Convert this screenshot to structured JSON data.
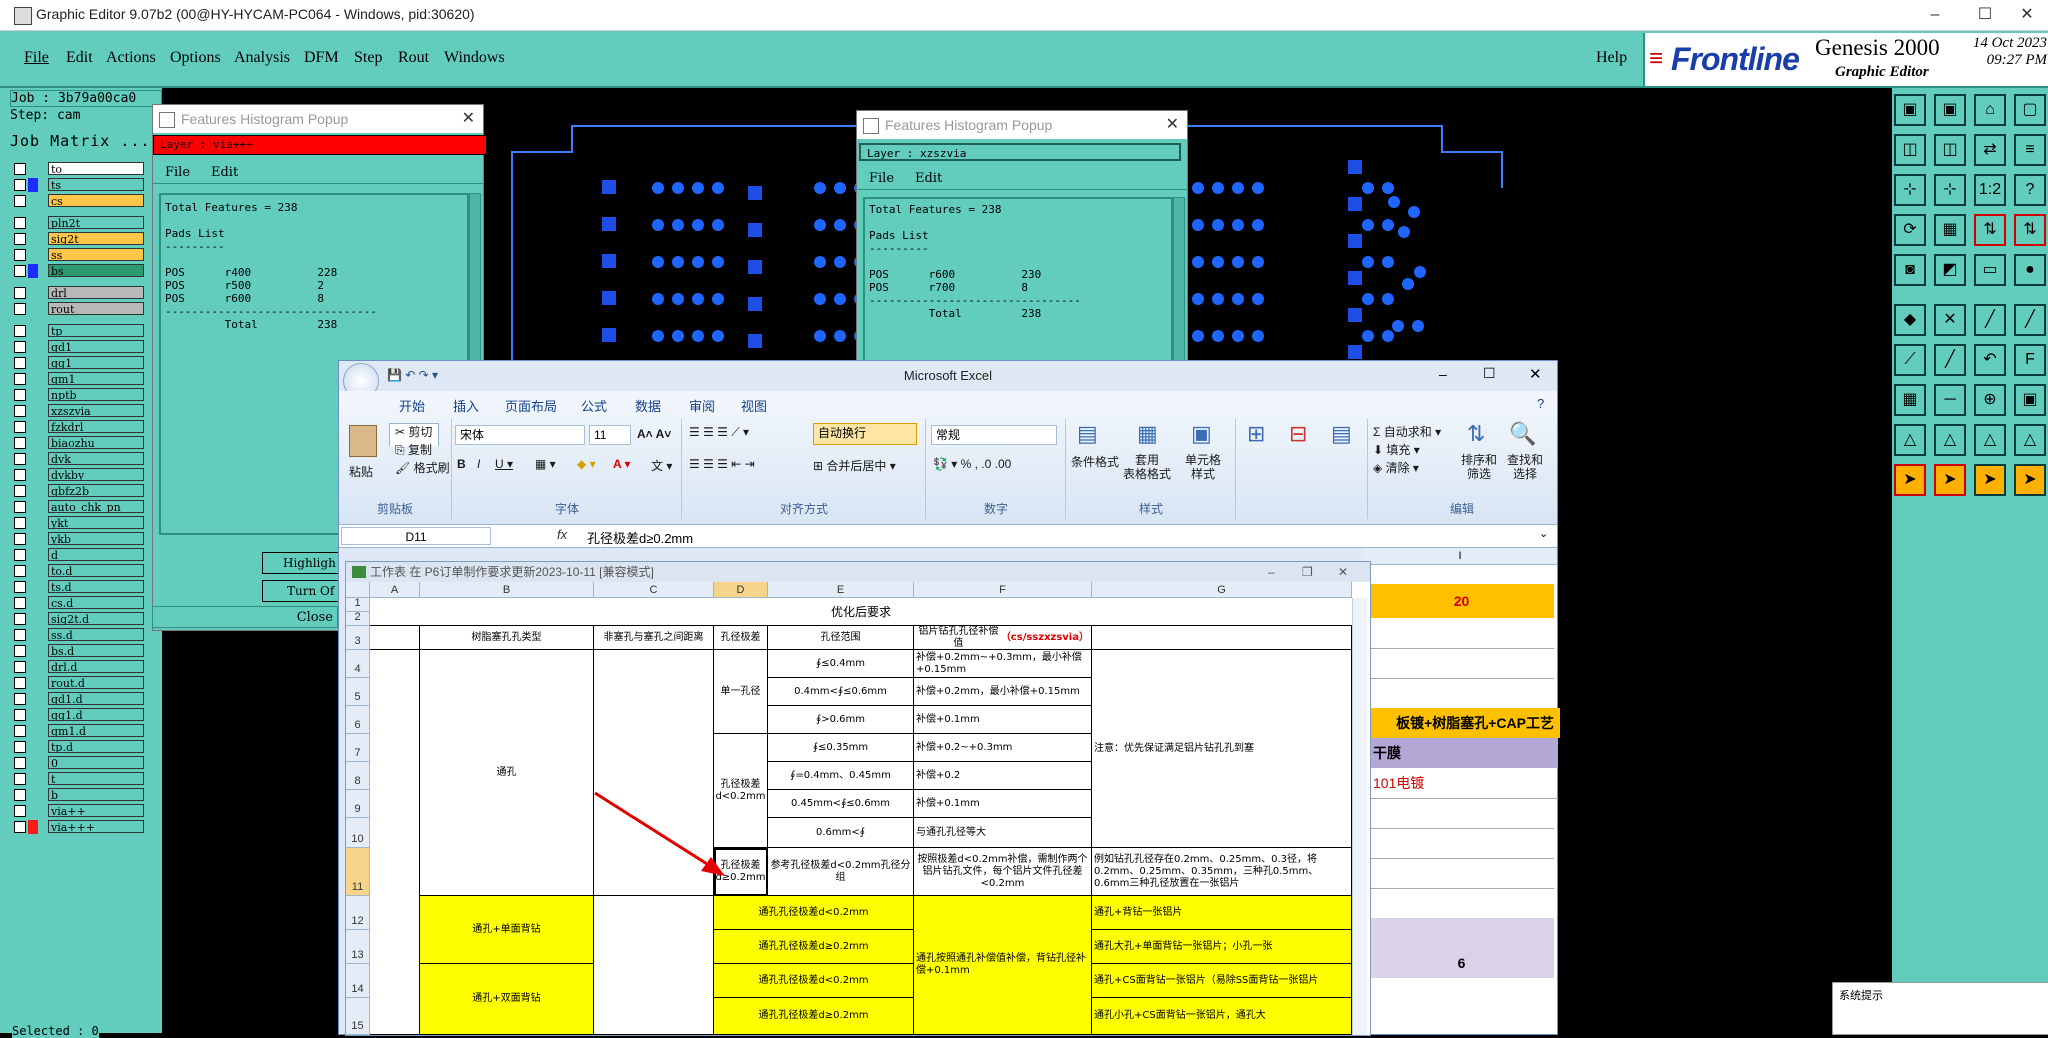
{
  "genesis": {
    "title": "Graphic Editor 9.07b2 (00@HY-HYCAM-PC064 - Windows, pid:30620)",
    "menu": [
      "File",
      "Edit",
      "Actions",
      "Options",
      "Analysis",
      "DFM",
      "Step",
      "Rout",
      "Windows"
    ],
    "help": "Help",
    "brand": "Frontline",
    "product": "Genesis 2000",
    "subtitle": "Graphic Editor",
    "date": "14 Oct 2023",
    "time": "09:27 PM",
    "job_line": "Job : 3b79a00ca0",
    "step_line": "Step: cam",
    "job_matrix": "Job Matrix ...",
    "selected": "Selected : 0"
  },
  "layers": [
    {
      "name": "to",
      "color": "#ffffff",
      "sw": "#62cdbd"
    },
    {
      "name": "ts",
      "color": "#62cdbd",
      "sw": "#1e2cff"
    },
    {
      "name": "cs",
      "color": "#ffc64a",
      "sw": "#62cdbd"
    },
    {
      "name": "pln2t",
      "color": "#62cdbd",
      "sw": "#62cdbd"
    },
    {
      "name": "sig2t",
      "color": "#ffc64a",
      "sw": "#62cdbd"
    },
    {
      "name": "ss",
      "color": "#ffc64a",
      "sw": "#62cdbd"
    },
    {
      "name": "bs",
      "color": "#2d9a70",
      "sw": "#1e2cff"
    },
    {
      "name": "drl",
      "color": "#b8b8b8",
      "sw": "#62cdbd"
    },
    {
      "name": "rout",
      "color": "#b8b8b8",
      "sw": "#62cdbd"
    },
    {
      "name": "tp",
      "color": "#62cdbd",
      "sw": "#62cdbd"
    },
    {
      "name": "gd1",
      "color": "#62cdbd",
      "sw": "#62cdbd"
    },
    {
      "name": "gg1",
      "color": "#62cdbd",
      "sw": "#62cdbd"
    },
    {
      "name": "gm1",
      "color": "#62cdbd",
      "sw": "#62cdbd"
    },
    {
      "name": "nptb",
      "color": "#62cdbd",
      "sw": "#62cdbd"
    },
    {
      "name": "xzszvia",
      "color": "#62cdbd",
      "sw": "#62cdbd"
    },
    {
      "name": "fzkdrl",
      "color": "#62cdbd",
      "sw": "#62cdbd"
    },
    {
      "name": "biaozhu",
      "color": "#62cdbd",
      "sw": "#62cdbd"
    },
    {
      "name": "dvk",
      "color": "#62cdbd",
      "sw": "#62cdbd"
    },
    {
      "name": "dvkby",
      "color": "#62cdbd",
      "sw": "#62cdbd"
    },
    {
      "name": "gbfz2b",
      "color": "#62cdbd",
      "sw": "#62cdbd"
    },
    {
      "name": "auto_chk_pn",
      "color": "#62cdbd",
      "sw": "#62cdbd"
    },
    {
      "name": "ykt",
      "color": "#62cdbd",
      "sw": "#62cdbd"
    },
    {
      "name": "ykb",
      "color": "#62cdbd",
      "sw": "#62cdbd"
    },
    {
      "name": "d",
      "color": "#62cdbd",
      "sw": "#62cdbd"
    },
    {
      "name": "to.d",
      "color": "#62cdbd",
      "sw": "#62cdbd"
    },
    {
      "name": "ts.d",
      "color": "#62cdbd",
      "sw": "#62cdbd"
    },
    {
      "name": "cs.d",
      "color": "#62cdbd",
      "sw": "#62cdbd"
    },
    {
      "name": "sig2t.d",
      "color": "#62cdbd",
      "sw": "#62cdbd"
    },
    {
      "name": "ss.d",
      "color": "#62cdbd",
      "sw": "#62cdbd"
    },
    {
      "name": "bs.d",
      "color": "#62cdbd",
      "sw": "#62cdbd"
    },
    {
      "name": "drl.d",
      "color": "#62cdbd",
      "sw": "#62cdbd"
    },
    {
      "name": "rout.d",
      "color": "#62cdbd",
      "sw": "#62cdbd"
    },
    {
      "name": "gd1.d",
      "color": "#62cdbd",
      "sw": "#62cdbd"
    },
    {
      "name": "gg1.d",
      "color": "#62cdbd",
      "sw": "#62cdbd"
    },
    {
      "name": "gm1.d",
      "color": "#62cdbd",
      "sw": "#62cdbd"
    },
    {
      "name": "tp.d",
      "color": "#62cdbd",
      "sw": "#62cdbd"
    },
    {
      "name": "0",
      "color": "#62cdbd",
      "sw": "#62cdbd"
    },
    {
      "name": "t",
      "color": "#62cdbd",
      "sw": "#62cdbd"
    },
    {
      "name": "b",
      "color": "#62cdbd",
      "sw": "#62cdbd"
    },
    {
      "name": "via++",
      "color": "#62cdbd",
      "sw": "#62cdbd"
    },
    {
      "name": "via+++",
      "color": "#62cdbd",
      "sw": "#ff1a1a"
    }
  ],
  "popup1": {
    "title": "Features Histogram Popup",
    "layer": "Layer :  via+++",
    "menu_file": "File",
    "menu_edit": "Edit",
    "body": "Total Features = 238\n\nPads List\n---------\n\nPOS      r400          228\nPOS      r500          2\nPOS      r600          8\n--------------------------------\n         Total         238",
    "highlight": "Highligh",
    "turn_off": "Turn Of",
    "close": "Close"
  },
  "popup2": {
    "title": "Features Histogram Popup",
    "layer": "Layer :  xzszvia",
    "menu_file": "File",
    "menu_edit": "Edit",
    "body": "Total Features = 238\n\nPads List\n---------\n\nPOS      r600          230\nPOS      r700          8\n--------------------------------\n         Total         238"
  },
  "excel": {
    "title": "Microsoft Excel",
    "tabs": [
      "开始",
      "插入",
      "页面布局",
      "公式",
      "数据",
      "审阅",
      "视图"
    ],
    "clipboard": {
      "paste": "粘贴",
      "cut": "剪切",
      "copy": "复制",
      "format_painter": "格式刷",
      "label": "剪贴板"
    },
    "font": {
      "name": "宋体",
      "size": "11",
      "label": "字体"
    },
    "align": {
      "wrap": "自动换行",
      "merge": "合并后居中",
      "label": "对齐方式"
    },
    "number": {
      "format": "常规",
      "label": "数字"
    },
    "styles": {
      "cond": "条件格式",
      "table": "套用\n表格格式",
      "cell": "单元格\n样式",
      "label": "样式"
    },
    "cells": {
      "header_opt": "优化后要求",
      "h_b": "树脂塞孔孔类型",
      "h_c": "非塞孔与塞孔之间距离",
      "h_d": "孔径极差",
      "h_e": "孔径范围",
      "h_f": "铝片钻孔孔径补偿值",
      "h_f_red": "（cs/sszxzsvia）",
      "b_through": "通孔",
      "d_single": "单一孔径",
      "d_lt": "孔径极差d<0.2mm",
      "d_ge": "孔径极差d≥0.2mm",
      "e4": "∮≤0.4mm",
      "e5": "0.4mm<∮≤0.6mm",
      "e6": "∮>0.6mm",
      "e7": "∮≤0.35mm",
      "e8": "∮=0.4mm、0.45mm",
      "e9": "0.45mm<∮≤0.6mm",
      "e10": "0.6mm<∮",
      "e11": "参考孔径极差d<0.2mm孔径分组",
      "f4": "补偿+0.2mm~+0.3mm，最小补偿+0.15mm",
      "f5": "补偿+0.2mm，最小补偿+0.15mm",
      "f6": "补偿+0.1mm",
      "f7": "补偿+0.2~+0.3mm",
      "f8": "补偿+0.2",
      "f9": "补偿+0.1mm",
      "f10": "与通孔孔径等大",
      "f11": "按照极差d<0.2mm补偿，需制作两个铝片钻孔文件，每个铝片文件孔径差<0.2mm",
      "g_note": "注意：优先保证满足铝片钻孔孔到塞",
      "g11": "例如钻孔孔径存在0.2mm、0.25mm、0.3径，将0.2mm、0.25mm、0.35mm，三种孔0.5mm、0.6mm三种孔径放置在一张铝片",
      "b12": "通孔+单面背钻",
      "b14": "通孔+双面背钻",
      "d12": "通孔孔径极差d<0.2mm",
      "d13": "通孔孔径极差d≥0.2mm",
      "d14": "通孔孔径极差d<0.2mm",
      "d15": "通孔孔径极差d≥0.2mm",
      "f12": "通孔按照通孔补偿值补偿，背钻孔径补偿+0.1mm",
      "g12": "通孔+背钻一张铝片",
      "g13": "通孔大孔+单面背钻一张铝片；小孔一张",
      "g14": "通孔+CS面背钻一张铝片（易除SS面背钻一张铝片",
      "g15": "通孔小孔+CS面背钻一张铝片，通孔大"
    },
    "edit": {
      "autosum": "自动求和",
      "fill": "填充",
      "clear": "清除",
      "sort": "排序和\n筛选",
      "find": "查找和\n选择",
      "label": "编辑"
    },
    "name_box": "D11",
    "fx": "fx",
    "formula": "孔径极差d≥0.2mm",
    "workbook_title": "工作表 在 P6订单制作要求更新2023-10-11  [兼容模式]",
    "columns": [
      "A",
      "B",
      "C",
      "D",
      "E",
      "F",
      "G",
      "I"
    ],
    "rows": [
      "1",
      "2",
      "3",
      "4",
      "5",
      "6",
      "7",
      "8",
      "9",
      "10",
      "11",
      "12",
      "13",
      "14",
      "15"
    ],
    "bg": {
      "v20": "20",
      "process": "板镀+树脂塞孔+CAP工艺",
      "film": "干膜",
      "plating": "101电镀",
      "six": "6"
    }
  },
  "system_prompt": "系统提示"
}
